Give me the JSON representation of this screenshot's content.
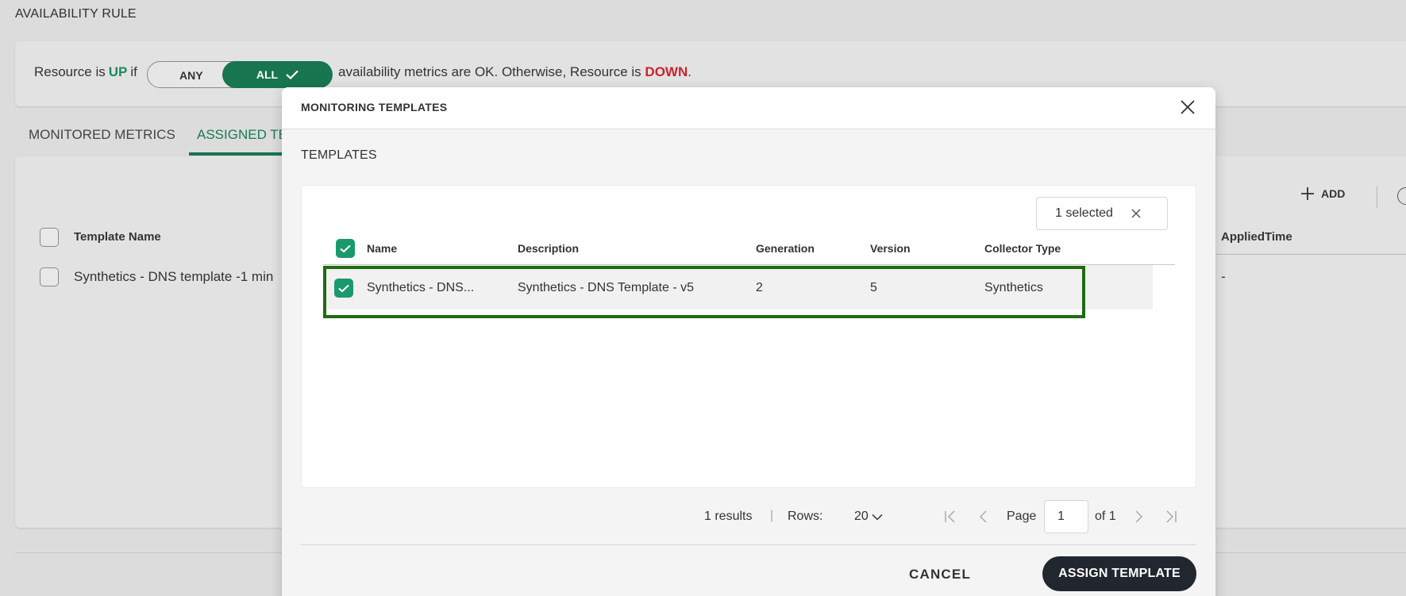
{
  "background": {
    "section_title": "AVAILABILITY RULE",
    "rule": {
      "prefix": "Resource is",
      "up": "UP",
      "if": "if",
      "toggle_any": "ANY",
      "toggle_all": "ALL",
      "middle": "availability metrics are OK. Otherwise, Resource is",
      "down": "DOWN",
      "suffix": "."
    },
    "tabs": {
      "monitored": "MONITORED METRICS",
      "assigned": "ASSIGNED TE"
    },
    "add_label": "ADD",
    "columns": {
      "template_name": "Template Name",
      "applied_time": "AppliedTime"
    },
    "row": {
      "template_name": "Synthetics - DNS template -1 min",
      "applied_time": "-"
    }
  },
  "modal": {
    "title": "MONITORING TEMPLATES",
    "section_title": "TEMPLATES",
    "selected_chip": "1 selected",
    "columns": [
      "Name",
      "Description",
      "Generation",
      "Version",
      "Collector Type"
    ],
    "rows": [
      {
        "name": "Synthetics - DNS...",
        "description": "Synthetics - DNS Template - v5",
        "generation": "2",
        "version": "5",
        "collector_type": "Synthetics"
      }
    ],
    "pagination": {
      "results": "1 results",
      "separator": "|",
      "rows_label": "Rows:",
      "rows_value": "20",
      "page_label": "Page",
      "page_value": "1",
      "of_label": "of 1"
    },
    "cancel": "CANCEL",
    "assign": "ASSIGN TEMPLATE"
  },
  "colors": {
    "accent_green": "#17754f",
    "checkbox_green": "#1a9a6c",
    "up_green": "#1a8a5b",
    "down_red": "#c8242b",
    "highlight_border": "#1f6b12",
    "primary_button": "#22262f"
  }
}
